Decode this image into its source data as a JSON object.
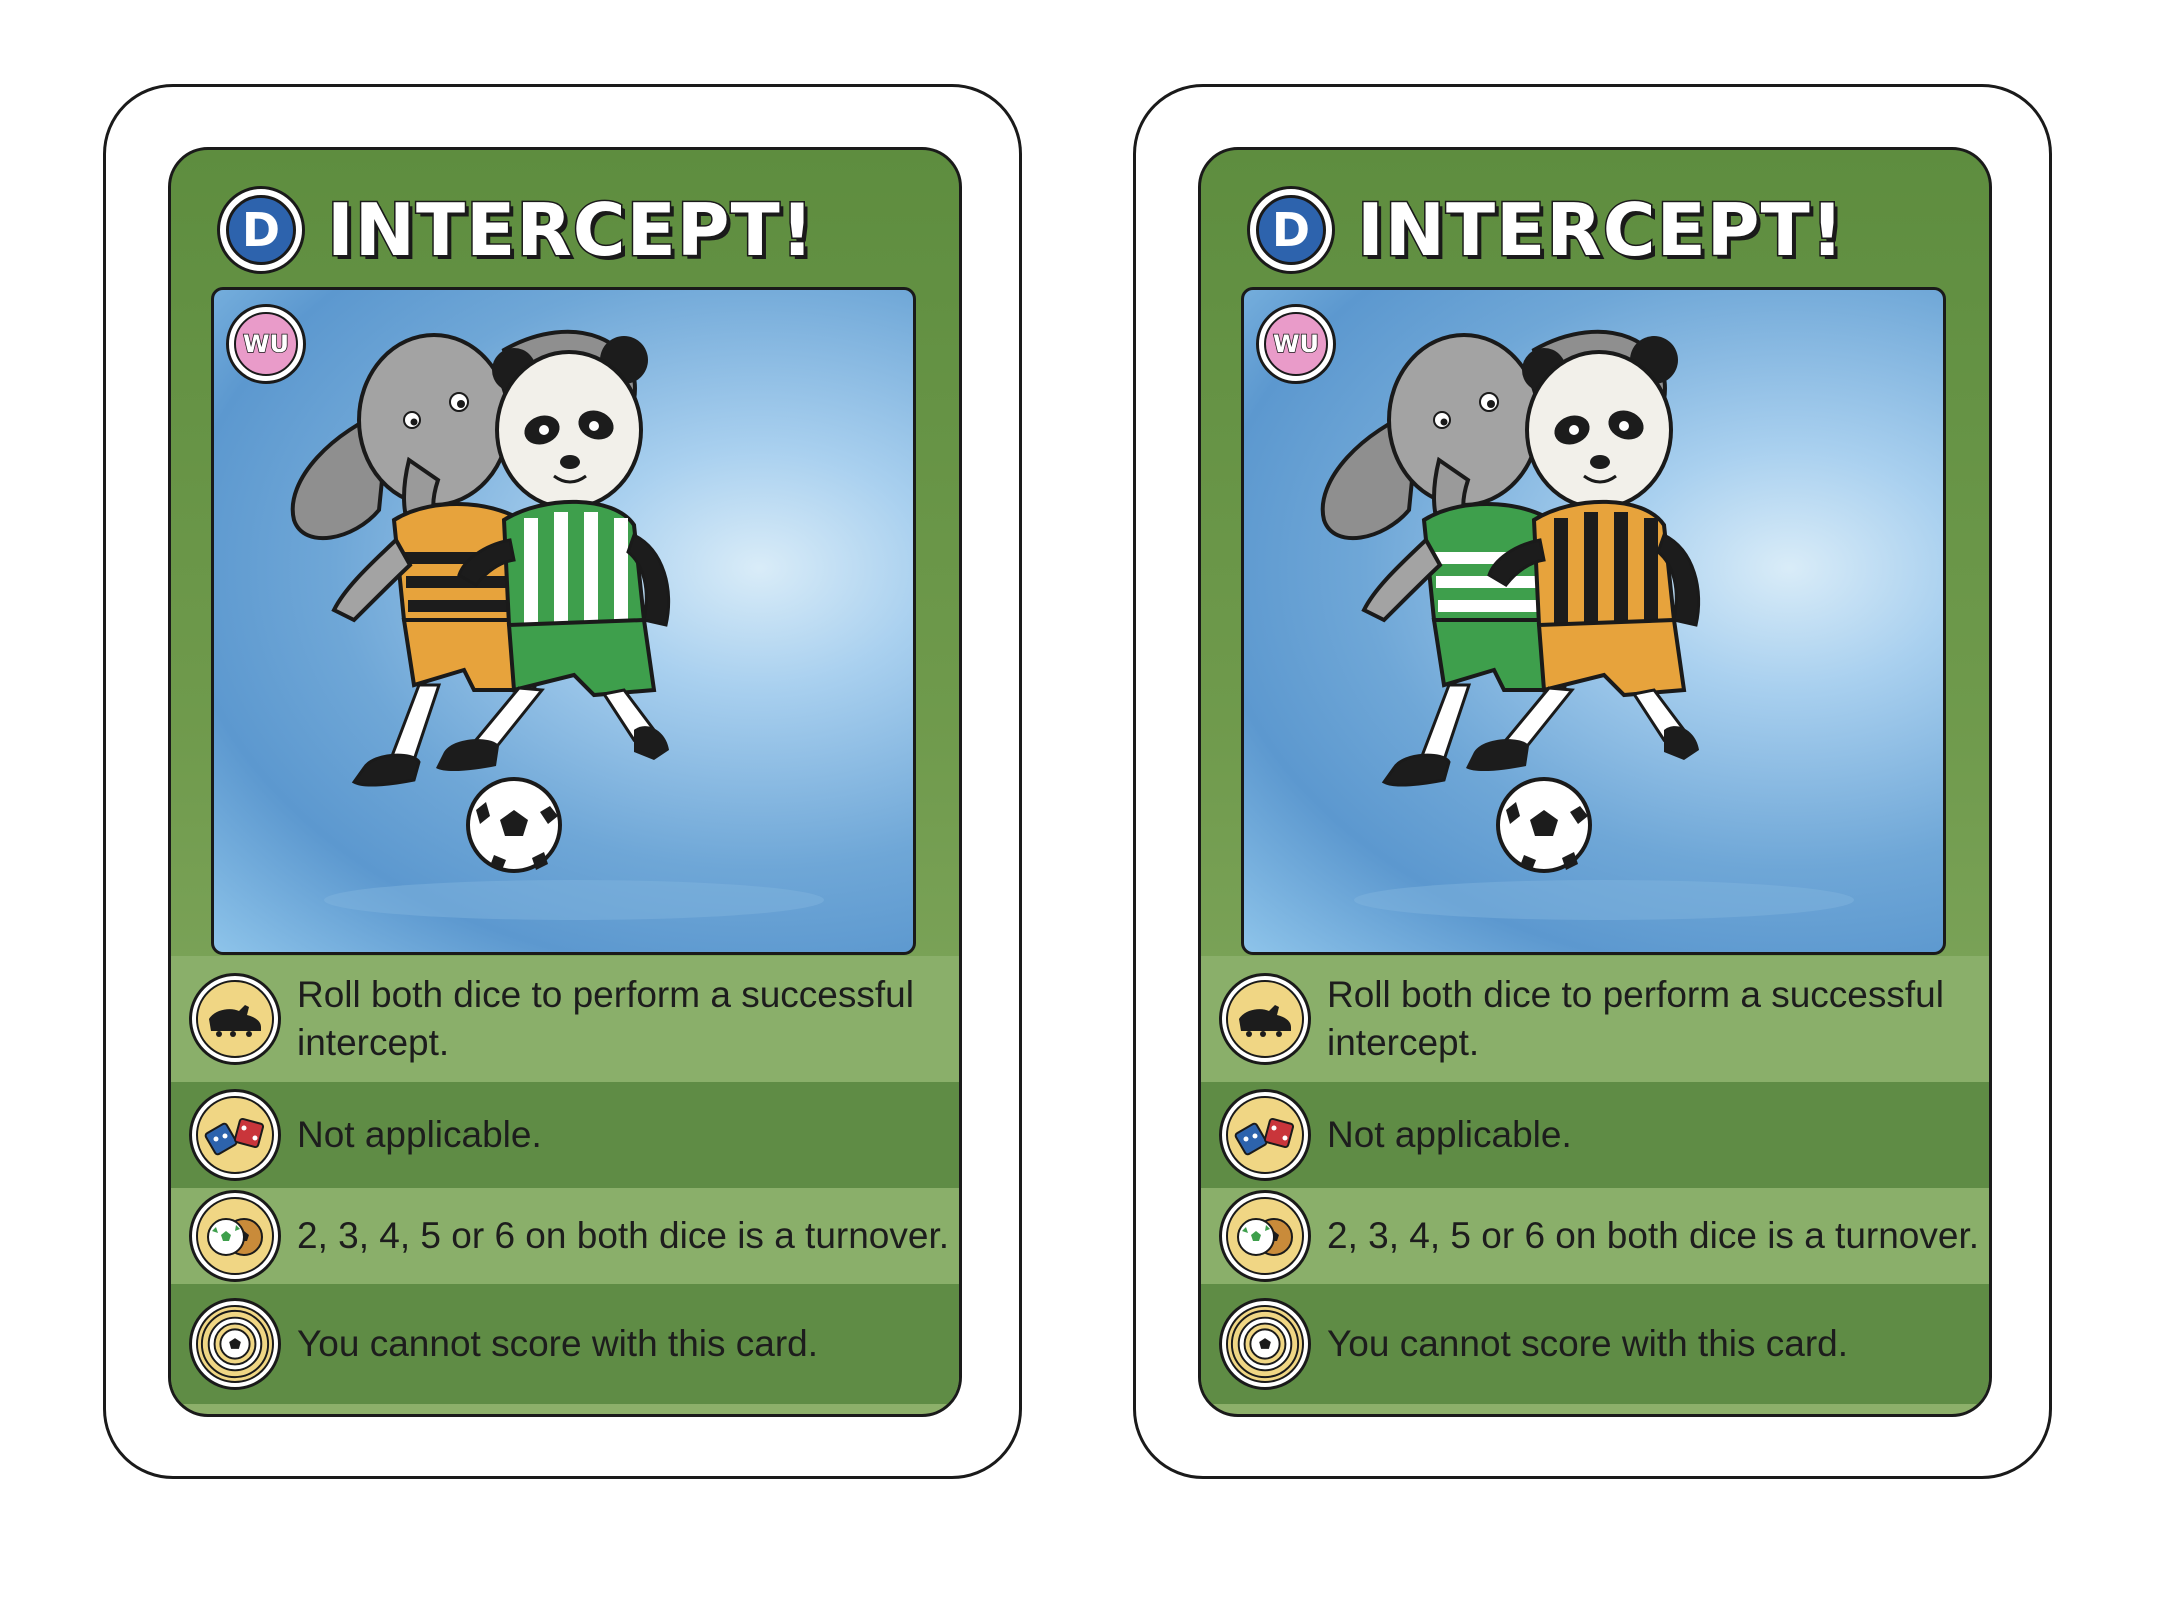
{
  "cards": [
    {
      "id": "card-a",
      "type_letter": "D",
      "title": "INTERCEPT!",
      "team_badge": "WU",
      "art": {
        "left_player": "elephant",
        "left_kit": "orange-black-striped",
        "right_player": "panda",
        "right_kit": "green-white-striped",
        "left_kit_colors": {
          "shirt_a": "#e7a33c",
          "shirt_b": "#1c1c1c",
          "shorts": "#e7a33c"
        },
        "right_kit_colors": {
          "shirt_a": "#3e9f4c",
          "shirt_b": "#ffffff",
          "shorts": "#3e9f4c"
        }
      },
      "rules": [
        {
          "icon": "boot-icon",
          "text": "Roll both dice to perform a successful intercept."
        },
        {
          "icon": "dice-icon",
          "text": "Not applicable."
        },
        {
          "icon": "balls-icon",
          "text": "2, 3, 4, 5 or 6 on both dice is a turnover."
        },
        {
          "icon": "goal-target-icon",
          "text": "You cannot score with this card."
        }
      ]
    },
    {
      "id": "card-b",
      "type_letter": "D",
      "title": "INTERCEPT!",
      "team_badge": "WU",
      "art": {
        "left_player": "elephant",
        "left_kit": "green-white-striped",
        "right_player": "panda",
        "right_kit": "orange-black-striped",
        "left_kit_colors": {
          "shirt_a": "#3e9f4c",
          "shirt_b": "#ffffff",
          "shorts": "#3e9f4c"
        },
        "right_kit_colors": {
          "shirt_a": "#e7a33c",
          "shirt_b": "#1c1c1c",
          "shorts": "#e7a33c"
        }
      },
      "rules": [
        {
          "icon": "boot-icon",
          "text": "Roll both dice to perform a successful intercept."
        },
        {
          "icon": "dice-icon",
          "text": "Not applicable."
        },
        {
          "icon": "balls-icon",
          "text": "2, 3, 4, 5 or 6 on both dice is a turnover."
        },
        {
          "icon": "goal-target-icon",
          "text": "You cannot score with this card."
        }
      ]
    }
  ],
  "colors": {
    "card_green": "#6f9a4c",
    "row_light": "#8aaf6a",
    "row_dark": "#5f8c45",
    "badge_blue": "#2d63ad",
    "team_pink": "#e99bc9",
    "icon_yellow": "#f0d684"
  }
}
